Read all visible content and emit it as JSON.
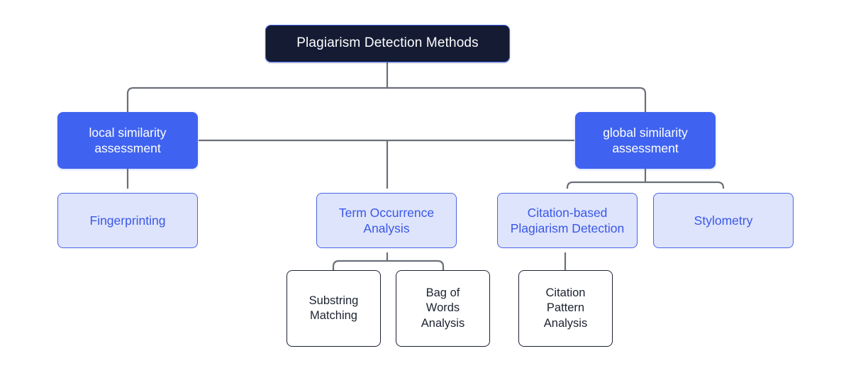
{
  "diagram": {
    "title": "Plagiarism Detection Methods",
    "type": "hierarchy-tree",
    "background_color": "#ffffff",
    "colors": {
      "root_fill": "#141b33",
      "root_text": "#ffffff",
      "branch_fill": "#3f63f0",
      "branch_text": "#ffffff",
      "leaf_fill": "#dee4fb",
      "leaf_border": "#4a63e8",
      "leaf_text": "#3a57e8",
      "plain_fill": "#ffffff",
      "plain_border": "#1c2230",
      "plain_text": "#1c2230",
      "connector": "#6b6f78"
    },
    "nodes": {
      "root": {
        "label": "Plagiarism Detection Methods"
      },
      "local": {
        "label": "local similarity\nassessment"
      },
      "global": {
        "label": "global similarity\nassessment"
      },
      "fingerprinting": {
        "label": "Fingerprinting"
      },
      "term_occurrence": {
        "label": "Term Occurrence\nAnalysis"
      },
      "citation_based": {
        "label": "Citation-based\nPlagiarism Detection"
      },
      "stylometry": {
        "label": "Stylometry"
      },
      "substring_matching": {
        "label": "Substring\nMatching"
      },
      "bag_of_words": {
        "label": "Bag of\nWords\nAnalysis"
      },
      "citation_pattern": {
        "label": "Citation\nPattern\nAnalysis"
      }
    }
  }
}
